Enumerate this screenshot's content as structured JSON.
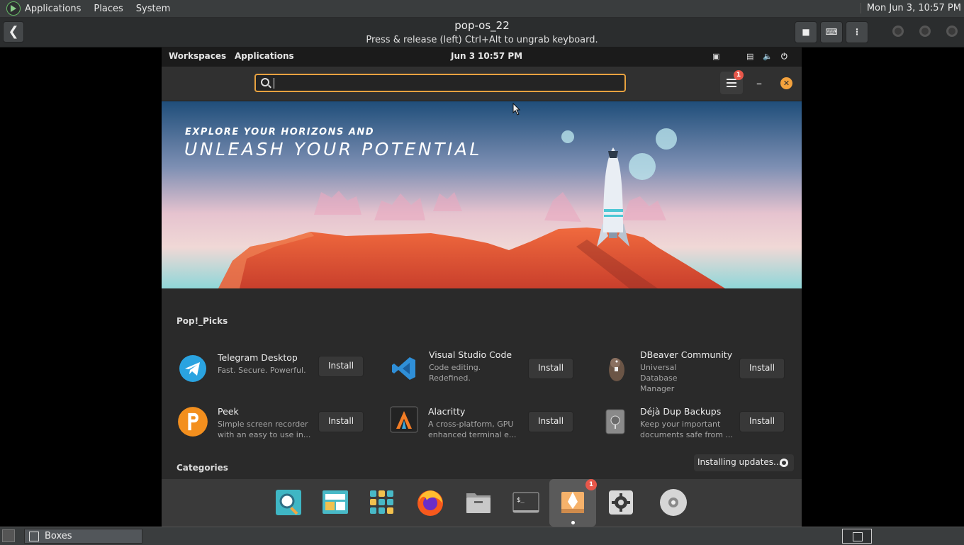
{
  "host_panel": {
    "menus": [
      "Applications",
      "Places",
      "System"
    ],
    "clock": "Mon Jun  3, 10:57 PM"
  },
  "boxes": {
    "title": "pop-os_22",
    "subtitle": "Press & release (left) Ctrl+Alt to ungrab keyboard."
  },
  "guest_bar": {
    "workspaces": "Workspaces",
    "applications": "Applications",
    "date": "Jun 3",
    "time": "10:57 PM"
  },
  "shop": {
    "search": {
      "value": "",
      "placeholder": ""
    },
    "menu_badge": "1",
    "banner": {
      "line1": "EXPLORE YOUR HORIZONS AND",
      "line2": "UNLEASH YOUR POTENTIAL"
    },
    "picks_title": "Pop!_Picks",
    "install_label": "Install",
    "apps": [
      {
        "name": "Telegram Desktop",
        "desc": "Fast. Secure. Powerful.",
        "icon": "telegram-icon"
      },
      {
        "name": "Visual Studio Code",
        "desc": "Code editing. Redefined.",
        "icon": "vscode-icon"
      },
      {
        "name": "DBeaver Community",
        "desc": "Universal Database Manager",
        "icon": "dbeaver-icon"
      },
      {
        "name": "Peek",
        "desc": "Simple screen recorder with an easy to use in...",
        "icon": "peek-icon"
      },
      {
        "name": "Alacritty",
        "desc": "A cross-platform, GPU enhanced terminal e...",
        "icon": "alacritty-icon"
      },
      {
        "name": "Déjà Dup Backups",
        "desc": "Keep your important documents safe from ...",
        "icon": "deja-dup-icon"
      }
    ],
    "categories_title": "Categories",
    "updates_label": "Installing updates...",
    "dock_badge": "1"
  },
  "dock": [
    "search-launcher-icon",
    "files-icon",
    "app-grid-icon",
    "firefox-icon",
    "file-manager-icon",
    "terminal-icon",
    "pop-shop-icon",
    "settings-icon",
    "disc-icon"
  ],
  "taskbar": {
    "item": "Boxes"
  },
  "colors": {
    "accent": "#e8a240",
    "close": "#f4a23d",
    "badge": "#e8574a"
  }
}
